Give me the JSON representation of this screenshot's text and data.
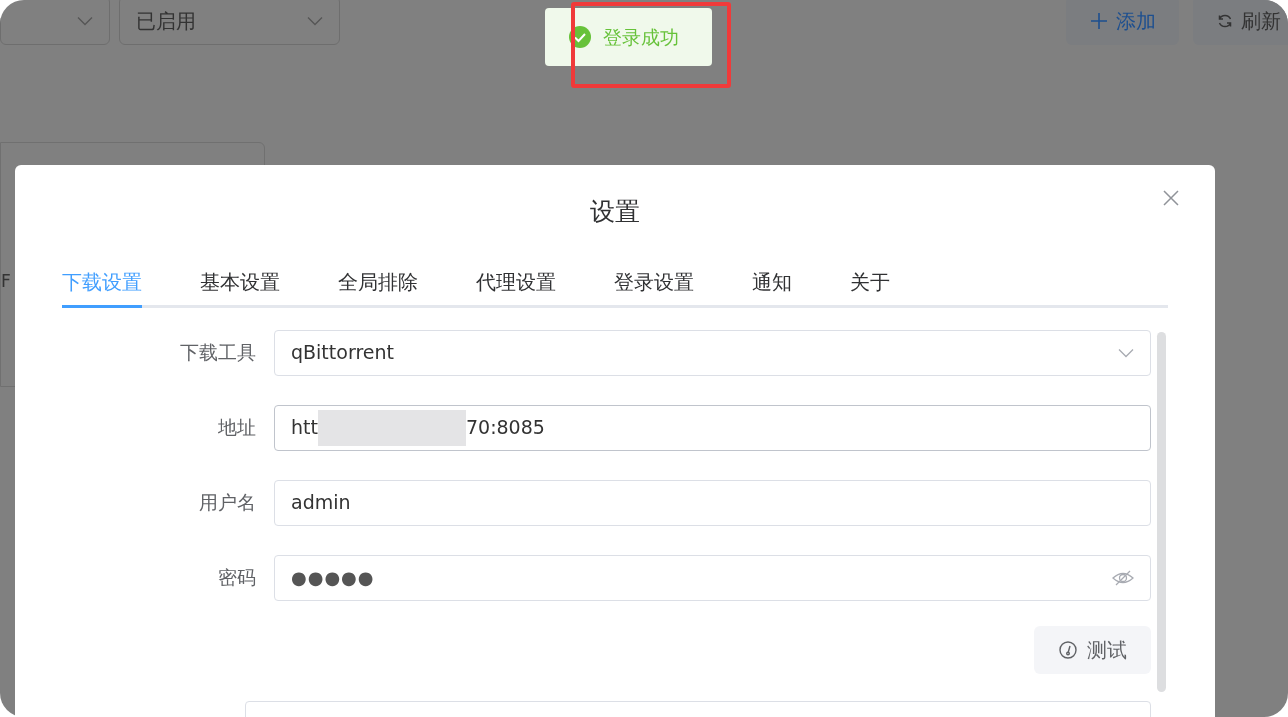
{
  "background": {
    "status_select": {
      "value": "已启用"
    },
    "add_button": {
      "label": "添加"
    },
    "refresh_button": {
      "label": "刷新"
    },
    "side_fragment": "F"
  },
  "toast": {
    "kind": "success",
    "message": "登录成功",
    "highlighted": true
  },
  "dialog": {
    "title": "设置",
    "tabs": [
      {
        "label": "下载设置",
        "selected": true
      },
      {
        "label": "基本设置",
        "selected": false
      },
      {
        "label": "全局排除",
        "selected": false
      },
      {
        "label": "代理设置",
        "selected": false
      },
      {
        "label": "登录设置",
        "selected": false
      },
      {
        "label": "通知",
        "selected": false
      },
      {
        "label": "关于",
        "selected": false
      }
    ],
    "fields": [
      {
        "kind": "select",
        "label": "下载工具",
        "value": "qBittorrent"
      },
      {
        "kind": "redacted",
        "label": "地址",
        "value_start": "htt",
        "value_end": "70:8085"
      },
      {
        "kind": "text",
        "label": "用户名",
        "value": "admin"
      },
      {
        "kind": "password",
        "label": "密码",
        "value": "●●●●●"
      }
    ],
    "test_button": {
      "label": "测试"
    }
  }
}
